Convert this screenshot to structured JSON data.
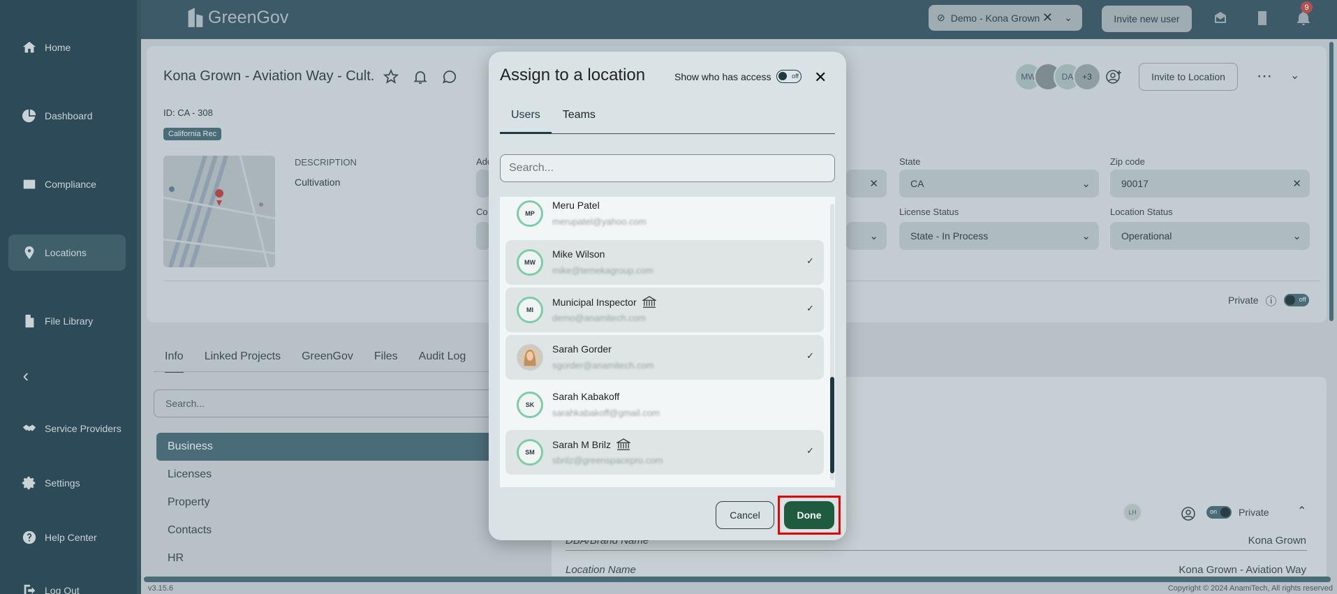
{
  "sidebar": {
    "items": [
      {
        "label": "Home",
        "icon": "home-icon"
      },
      {
        "label": "Dashboard",
        "icon": "pie-chart-icon"
      },
      {
        "label": "Compliance",
        "icon": "card-icon"
      },
      {
        "label": "Locations",
        "icon": "location-pin-icon"
      },
      {
        "label": "File Library",
        "icon": "file-icon"
      },
      {
        "label": "Service Providers",
        "icon": "handshake-icon"
      },
      {
        "label": "Settings",
        "icon": "gear-icon"
      },
      {
        "label": "Help Center",
        "icon": "help-icon"
      },
      {
        "label": "Log Out",
        "icon": "logout-icon"
      }
    ]
  },
  "topbar": {
    "brand": "GreenGov",
    "org_selector": "Demo - Kona Grown",
    "invite_user": "Invite new user",
    "notifications_count": "9"
  },
  "location": {
    "title": "Kona Grown - Aviation Way - Cult.",
    "id": "ID: CA - 308",
    "tag": "California Rec",
    "description_label": "DESCRIPTION",
    "description": "Cultivation",
    "field_labels": {
      "address": "Add",
      "county": "Co",
      "state": "State",
      "zip": "Zip code",
      "license_status": "License Status",
      "location_status": "Location Status"
    },
    "state_value": "CA",
    "zip_value": "90017",
    "license_status_value": "State - In Process",
    "location_status_value": "Operational",
    "avatars": [
      "MW",
      "DA",
      "+3"
    ],
    "invite_to_location": "Invite to Location",
    "private_label": "Private",
    "private_toggle": "off"
  },
  "tabs": [
    "Info",
    "Linked Projects",
    "GreenGov",
    "Files",
    "Audit Log"
  ],
  "left_search_placeholder": "Search...",
  "sections": [
    "Business",
    "Licenses",
    "Property",
    "Contacts",
    "HR"
  ],
  "right_panel": {
    "dba_label": "DBA/Brand Name",
    "dba_value": "Kona Grown",
    "location_name_label": "Location Name",
    "location_name_value": "Kona Grown - Aviation Way",
    "lh": "LH",
    "private_label": "Private",
    "private_toggle": "on"
  },
  "footer": {
    "version": "v3.15.6",
    "copyright": "Copyright © 2024 AnamiTech, All rights reserved"
  },
  "modal": {
    "title": "Assign to a location",
    "show_access_label": "Show who has access",
    "show_access_toggle": "off",
    "tabs": [
      "Users",
      "Teams"
    ],
    "search_placeholder": "Search...",
    "users": [
      {
        "initials": "MP",
        "name": "Meru Patel",
        "email": "merupatel@yahoo.com",
        "selected": false,
        "gov": false
      },
      {
        "initials": "MW",
        "name": "Mike Wilson",
        "email": "mike@temekagroup.com",
        "selected": true,
        "gov": false
      },
      {
        "initials": "MI",
        "name": "Municipal Inspector",
        "email": "demo@anamitech.com",
        "selected": true,
        "gov": true
      },
      {
        "initials": "",
        "name": "Sarah Gorder",
        "email": "sgorder@anamitech.com",
        "selected": true,
        "gov": false
      },
      {
        "initials": "SK",
        "name": "Sarah Kabakoff",
        "email": "sarahkabakoff@gmail.com",
        "selected": false,
        "gov": false
      },
      {
        "initials": "SM",
        "name": "Sarah M Brilz",
        "email": "sbrilz@greenspacepro.com",
        "selected": true,
        "gov": true
      }
    ],
    "cancel_label": "Cancel",
    "done_label": "Done"
  },
  "colors": {
    "sidebar": "#2c4a57",
    "done_button": "#1f5c3f",
    "highlight": "#e00000",
    "avatar_ring": "#7fcaa9"
  }
}
